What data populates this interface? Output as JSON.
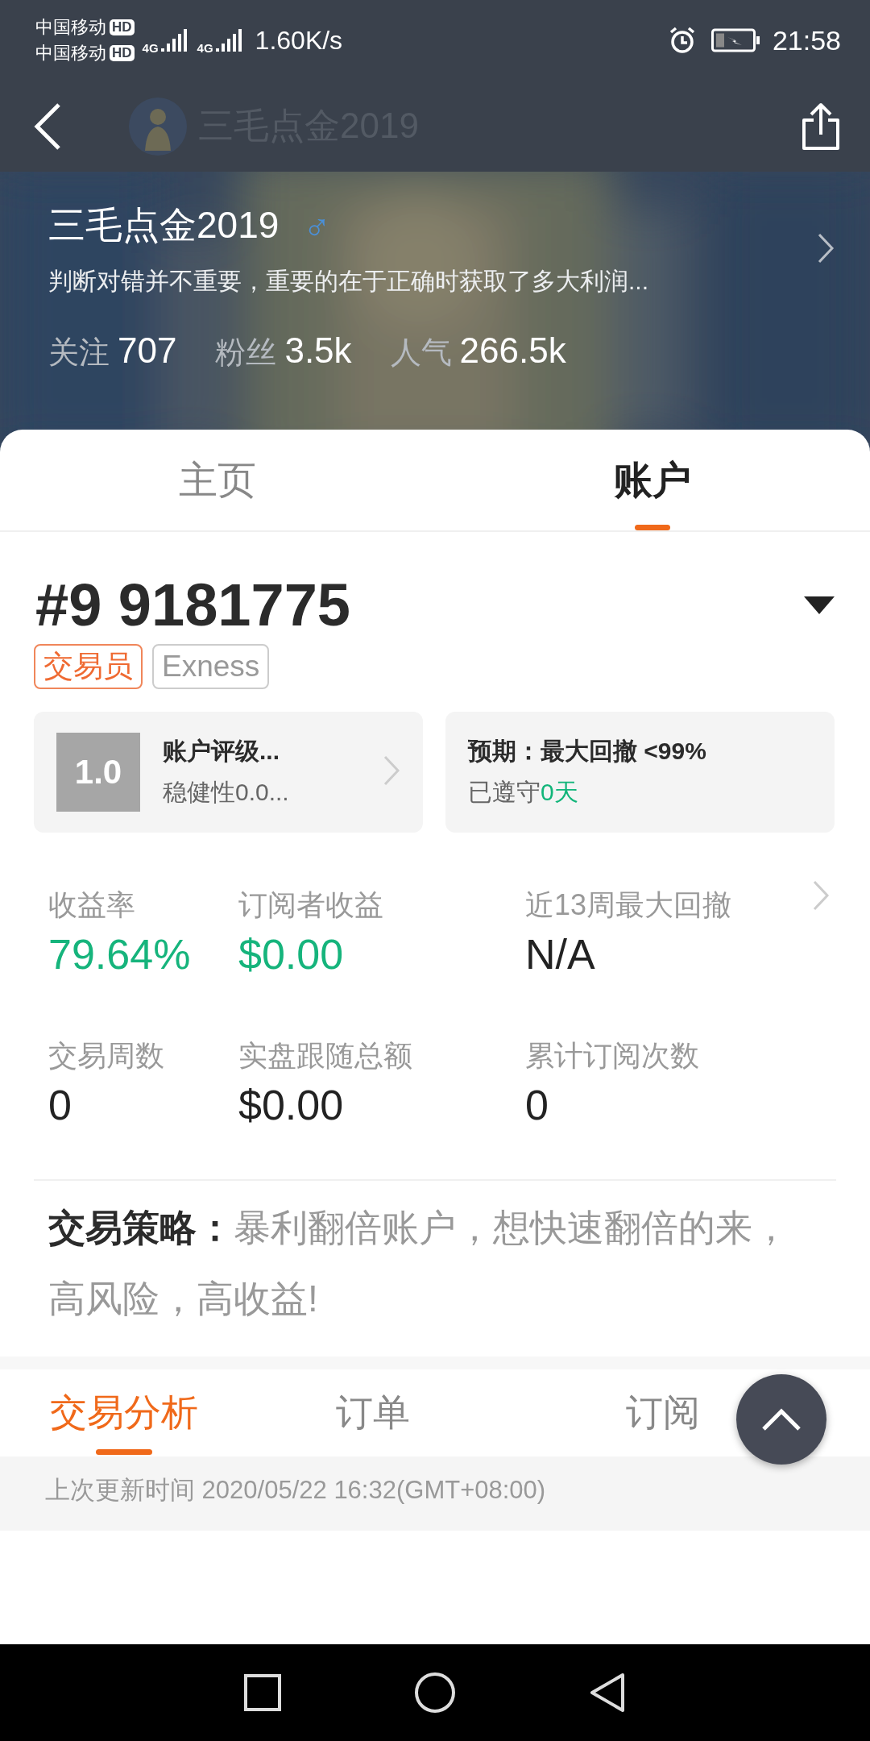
{
  "status_bar": {
    "carriers": [
      {
        "name": "中国移动",
        "badge": "HD"
      },
      {
        "name": "中国移动",
        "badge": "HD"
      }
    ],
    "networks": [
      "4G",
      "4G"
    ],
    "speed": "1.60K/s",
    "time": "21:58"
  },
  "nav": {
    "title": "三毛点金2019"
  },
  "profile": {
    "name": "三毛点金2019",
    "gender": "♂",
    "bio": "判断对错并不重要，重要的在于正确时获取了多大利润...",
    "stats": [
      {
        "label": "关注",
        "value": "707"
      },
      {
        "label": "粉丝",
        "value": "3.5k"
      },
      {
        "label": "人气",
        "value": "266.5k"
      }
    ]
  },
  "tabs": [
    {
      "label": "主页",
      "selected": false
    },
    {
      "label": "账户",
      "selected": true
    }
  ],
  "account": {
    "number": "#9 9181775",
    "tags": [
      {
        "label": "交易员",
        "kind": "role"
      },
      {
        "label": "Exness",
        "kind": "broker"
      }
    ],
    "rating": {
      "score": "1.0",
      "title": "账户评级...",
      "subtitle": "稳健性0.0..."
    },
    "expectation": {
      "title": "预期：最大回撤 <99%",
      "status": "已遵守",
      "days": "0天"
    }
  },
  "metrics": [
    {
      "label": "收益率",
      "value": "79.64%",
      "positive": true
    },
    {
      "label": "订阅者收益",
      "value": "$0.00",
      "positive": true
    },
    {
      "label": "近13周最大回撤",
      "value": "N/A",
      "positive": false
    },
    {
      "label": "交易周数",
      "value": "0",
      "positive": false
    },
    {
      "label": "实盘跟随总额",
      "value": "$0.00",
      "positive": false
    },
    {
      "label": "累计订阅次数",
      "value": "0",
      "positive": false
    }
  ],
  "strategy": {
    "label": "交易策略：",
    "text": "暴利翻倍账户，想快速翻倍的来，高风险，高收益!"
  },
  "sub_tabs": [
    {
      "label": "交易分析",
      "selected": true
    },
    {
      "label": "订单",
      "selected": false
    },
    {
      "label": "订阅",
      "selected": false
    }
  ],
  "updated": "上次更新时间 2020/05/22 16:32(GMT+08:00)"
}
